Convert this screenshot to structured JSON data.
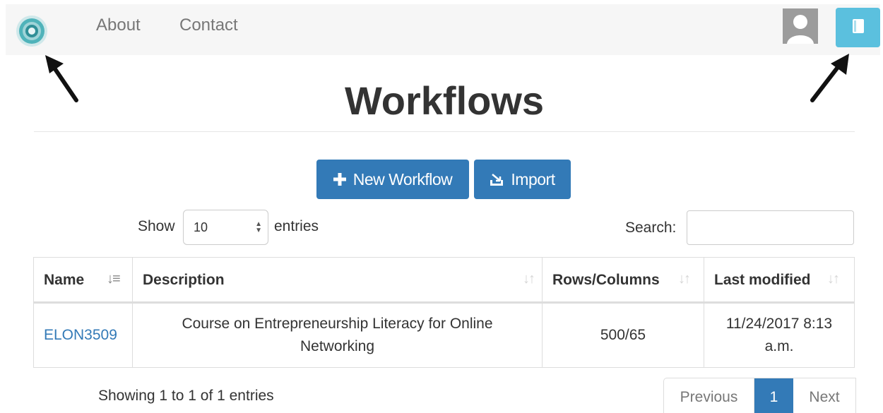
{
  "nav": {
    "about": "About",
    "contact": "Contact"
  },
  "page": {
    "title": "Workflows"
  },
  "actions": {
    "new_workflow": "New Workflow",
    "import": "Import"
  },
  "controls": {
    "show_label": "Show",
    "entries_value": "10",
    "entries_label": "entries",
    "search_label": "Search:",
    "search_value": ""
  },
  "table": {
    "headers": [
      "Name",
      "Description",
      "Rows/Columns",
      "Last modified"
    ],
    "rows": [
      {
        "name": "ELON3509",
        "description": "Course on Entrepreneurship Literacy for Online Networking",
        "rows_columns": "500/65",
        "last_modified": "11/24/2017 8:13 a.m."
      }
    ]
  },
  "footer": {
    "showing": "Showing 1 to 1 of 1 entries",
    "previous": "Previous",
    "current_page": "1",
    "next": "Next"
  },
  "colors": {
    "primary": "#337ab7",
    "info": "#5bc0de",
    "navbar_bg": "#f6f6f6"
  },
  "icons": [
    "app-logo-icon",
    "user-avatar-icon",
    "book-icon",
    "plus-icon",
    "import-icon",
    "sort-icon",
    "arrow-icon"
  ]
}
